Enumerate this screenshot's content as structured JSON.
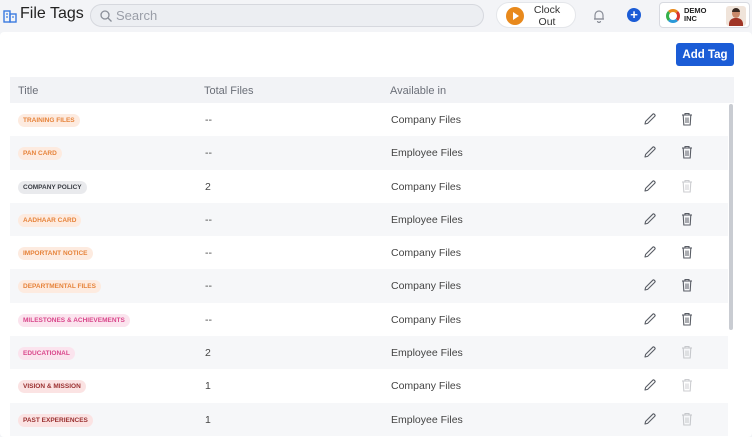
{
  "header": {
    "title": "File Tags",
    "search_placeholder": "Search",
    "clock_label": "Clock Out",
    "company": "DEMO INC"
  },
  "toolbar": {
    "add_tag_label": "Add Tag"
  },
  "table": {
    "columns": [
      "Title",
      "Total Files",
      "Available in"
    ],
    "rows": [
      {
        "title": "TRAINING FILES",
        "total": "--",
        "available": "Company Files",
        "color": "orange",
        "delete_enabled": true
      },
      {
        "title": "PAN CARD",
        "total": "--",
        "available": "Employee Files",
        "color": "orange",
        "delete_enabled": true
      },
      {
        "title": "COMPANY POLICY",
        "total": "2",
        "available": "Company Files",
        "color": "gray",
        "delete_enabled": false
      },
      {
        "title": "AADHAAR CARD",
        "total": "--",
        "available": "Employee Files",
        "color": "orange",
        "delete_enabled": true
      },
      {
        "title": "IMPORTANT NOTICE",
        "total": "--",
        "available": "Company Files",
        "color": "orange",
        "delete_enabled": true
      },
      {
        "title": "DEPARTMENTAL FILES",
        "total": "--",
        "available": "Company Files",
        "color": "orange",
        "delete_enabled": true
      },
      {
        "title": "MILESTONES & ACHIEVEMENTS",
        "total": "--",
        "available": "Company Files",
        "color": "pink",
        "delete_enabled": true
      },
      {
        "title": "EDUCATIONAL",
        "total": "2",
        "available": "Employee Files",
        "color": "pink",
        "delete_enabled": false
      },
      {
        "title": "VISION & MISSION",
        "total": "1",
        "available": "Company Files",
        "color": "rose",
        "delete_enabled": false
      },
      {
        "title": "PAST EXPERIENCES",
        "total": "1",
        "available": "Employee Files",
        "color": "rose",
        "delete_enabled": false
      }
    ]
  },
  "colors": {
    "primary": "#1b5cd6",
    "clock_accent": "#e8891c",
    "tag_orange": "#e6833a",
    "tag_gray": "#3a3d44",
    "tag_pink": "#d9468b",
    "tag_rose": "#9a3030"
  },
  "icons": {
    "logo": "building-icon",
    "search": "search-icon",
    "clock": "play-icon",
    "notifications": "bell-icon",
    "add": "plus-circle-icon",
    "edit": "pencil-icon",
    "delete": "trash-icon"
  }
}
